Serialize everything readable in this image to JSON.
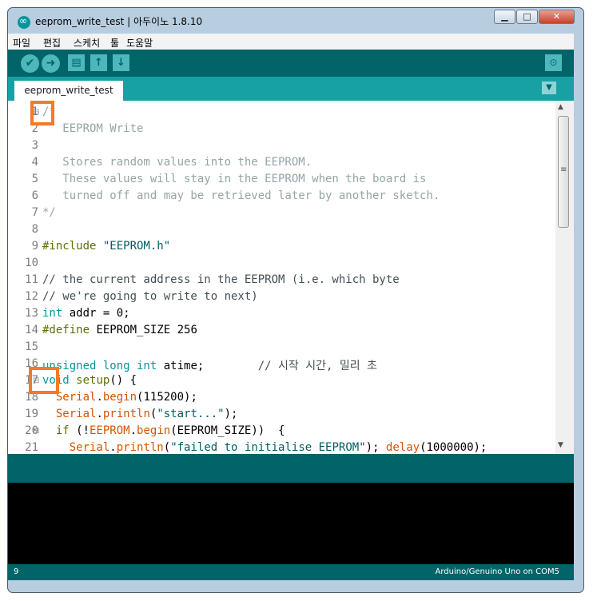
{
  "window": {
    "title": "eeprom_write_test | 아두이노 1.8.10",
    "min_glyph": "▁",
    "max_glyph": "□",
    "close_glyph": "✕"
  },
  "menu": [
    "파일",
    "편집",
    "스케치",
    "툴",
    "도움말"
  ],
  "toolbar": {
    "verify_icon": "✔",
    "upload_icon": "➜",
    "new_icon": "▤",
    "open_icon": "↑",
    "save_icon": "↓",
    "serial_monitor_icon": "⊙"
  },
  "tabs": [
    {
      "label": "eeprom_write_test"
    }
  ],
  "tab_menu_icon": "▼",
  "code_lines": [
    {
      "n": "1",
      "fold": "⊟",
      "segments": [
        {
          "t": "/*",
          "c": "#95a5a6"
        }
      ]
    },
    {
      "n": "2",
      "fold": "",
      "segments": [
        {
          "t": "   EEPROM Write",
          "c": "#95a5a6"
        }
      ]
    },
    {
      "n": "3",
      "fold": "",
      "segments": [
        {
          "t": "",
          "c": "#95a5a6"
        }
      ]
    },
    {
      "n": "4",
      "fold": "",
      "segments": [
        {
          "t": "   Stores random values into the EEPROM.",
          "c": "#95a5a6"
        }
      ]
    },
    {
      "n": "5",
      "fold": "",
      "segments": [
        {
          "t": "   These values will stay in the EEPROM when the board is",
          "c": "#95a5a6"
        }
      ]
    },
    {
      "n": "6",
      "fold": "",
      "segments": [
        {
          "t": "   turned off and may be retrieved later by another sketch.",
          "c": "#95a5a6"
        }
      ]
    },
    {
      "n": "7",
      "fold": "",
      "segments": [
        {
          "t": "*/",
          "c": "#95a5a6"
        }
      ]
    },
    {
      "n": "8",
      "fold": "",
      "segments": []
    },
    {
      "n": "9",
      "fold": "",
      "segments": [
        {
          "t": "#include ",
          "c": "#5e6d03"
        },
        {
          "t": "\"EEPROM.h\"",
          "c": "#005c5f"
        }
      ]
    },
    {
      "n": "10",
      "fold": "",
      "segments": []
    },
    {
      "n": "11",
      "fold": "",
      "segments": [
        {
          "t": "// the current address in the EEPROM (i.e. which byte",
          "c": "#434f54"
        }
      ]
    },
    {
      "n": "12",
      "fold": "",
      "segments": [
        {
          "t": "// we're going to write to next)",
          "c": "#434f54"
        }
      ]
    },
    {
      "n": "13",
      "fold": "",
      "segments": [
        {
          "t": "int",
          "c": "#00979c"
        },
        {
          "t": " addr = 0;",
          "c": "#000000"
        }
      ]
    },
    {
      "n": "14",
      "fold": "",
      "segments": [
        {
          "t": "#define",
          "c": "#5e6d03"
        },
        {
          "t": " EEPROM_SIZE 256",
          "c": "#000000"
        }
      ]
    },
    {
      "n": "15",
      "fold": "",
      "segments": []
    },
    {
      "n": "16",
      "fold": "",
      "segments": [
        {
          "t": "unsigned long int",
          "c": "#00979c"
        },
        {
          "t": " atime;        ",
          "c": "#000000"
        },
        {
          "t": "// 시작 시간, 밀리 초",
          "c": "#434f54"
        }
      ]
    },
    {
      "n": "17",
      "fold": "⊟",
      "segments": [
        {
          "t": "void",
          "c": "#00979c"
        },
        {
          "t": " ",
          "c": "#000000"
        },
        {
          "t": "setup",
          "c": "#5e6d03"
        },
        {
          "t": "() {",
          "c": "#000000"
        }
      ]
    },
    {
      "n": "18",
      "fold": "",
      "segments": [
        {
          "t": "  ",
          "c": "#000000"
        },
        {
          "t": "Serial",
          "c": "#d35400"
        },
        {
          "t": ".",
          "c": "#000000"
        },
        {
          "t": "begin",
          "c": "#d35400"
        },
        {
          "t": "(115200);",
          "c": "#000000"
        }
      ]
    },
    {
      "n": "19",
      "fold": "",
      "segments": [
        {
          "t": "  ",
          "c": "#000000"
        },
        {
          "t": "Serial",
          "c": "#d35400"
        },
        {
          "t": ".",
          "c": "#000000"
        },
        {
          "t": "println",
          "c": "#d35400"
        },
        {
          "t": "(",
          "c": "#000000"
        },
        {
          "t": "\"start...\"",
          "c": "#005c5f"
        },
        {
          "t": ");",
          "c": "#000000"
        }
      ]
    },
    {
      "n": "20",
      "fold": "⊟",
      "segments": [
        {
          "t": "  ",
          "c": "#000000"
        },
        {
          "t": "if",
          "c": "#5e6d03"
        },
        {
          "t": " (!",
          "c": "#000000"
        },
        {
          "t": "EEPROM",
          "c": "#d35400"
        },
        {
          "t": ".",
          "c": "#000000"
        },
        {
          "t": "begin",
          "c": "#d35400"
        },
        {
          "t": "(EEPROM_SIZE))  {",
          "c": "#000000"
        }
      ]
    },
    {
      "n": "21",
      "fold": "",
      "segments": [
        {
          "t": "    ",
          "c": "#000000"
        },
        {
          "t": "Serial",
          "c": "#d35400"
        },
        {
          "t": ".",
          "c": "#000000"
        },
        {
          "t": "println",
          "c": "#d35400"
        },
        {
          "t": "(",
          "c": "#000000"
        },
        {
          "t": "\"failed to initialise EEPROM\"",
          "c": "#005c5f"
        },
        {
          "t": "); ",
          "c": "#000000"
        },
        {
          "t": "delay",
          "c": "#d35400"
        },
        {
          "t": "(1000000);",
          "c": "#000000"
        }
      ]
    }
  ],
  "scrollbar": {
    "up_glyph": "▲",
    "down_glyph": "▼",
    "grip_glyph": "≡"
  },
  "status": {
    "line": "9",
    "board": "Arduino/Genuino Uno on COM5"
  },
  "colors": {
    "accent": "#006468",
    "tabbar": "#17a1a5",
    "highlight": "#f47a28"
  }
}
